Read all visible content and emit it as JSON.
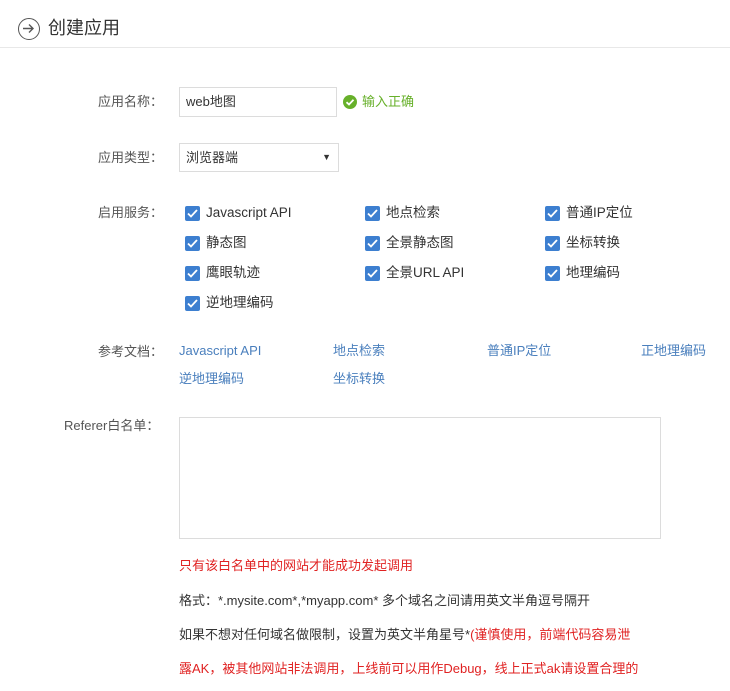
{
  "header": {
    "title": "创建应用",
    "back_icon": "circle-arrow-right-icon"
  },
  "form": {
    "app_name_label": "应用名称：",
    "app_name_value": "web地图",
    "app_name_status": "输入正确",
    "app_type_label": "应用类型：",
    "app_type_value": "浏览器端",
    "services_label": "启用服务：",
    "services": [
      {
        "label": "Javascript API",
        "checked": true
      },
      {
        "label": "地点检索",
        "checked": true
      },
      {
        "label": "普通IP定位",
        "checked": true
      },
      {
        "label": "静态图",
        "checked": true
      },
      {
        "label": "全景静态图",
        "checked": true
      },
      {
        "label": "坐标转换",
        "checked": true
      },
      {
        "label": "鹰眼轨迹",
        "checked": true
      },
      {
        "label": "全景URL API",
        "checked": true
      },
      {
        "label": "地理编码",
        "checked": true
      },
      {
        "label": "逆地理编码",
        "checked": true
      }
    ],
    "docs_label": "参考文档：",
    "docs": [
      {
        "label": "Javascript API"
      },
      {
        "label": "地点检索"
      },
      {
        "label": "普通IP定位"
      },
      {
        "label": "正地理编码"
      },
      {
        "label": "逆地理编码"
      },
      {
        "label": "坐标转换"
      }
    ],
    "referer_label": "Referer白名单：",
    "referer_value": "",
    "notes": {
      "warning": "只有该白名单中的网站才能成功发起调用",
      "format": "格式：*.mysite.com*,*myapp.com* 多个域名之间请用英文半角逗号隔开",
      "nolimit_prefix": "如果不想对任何域名做限制，设置为英文半角星号*",
      "nolimit_warning": "(谨慎使用，前端代码容易泄",
      "nolimit_warning_cont": "露AK，被其他网站非法调用，上线前可以用作Debug，线上正式ak请设置合理的"
    }
  },
  "colors": {
    "accent": "#3d7fd0",
    "link": "#4a7fbd",
    "success": "#67b02a",
    "warning": "#e02222"
  }
}
